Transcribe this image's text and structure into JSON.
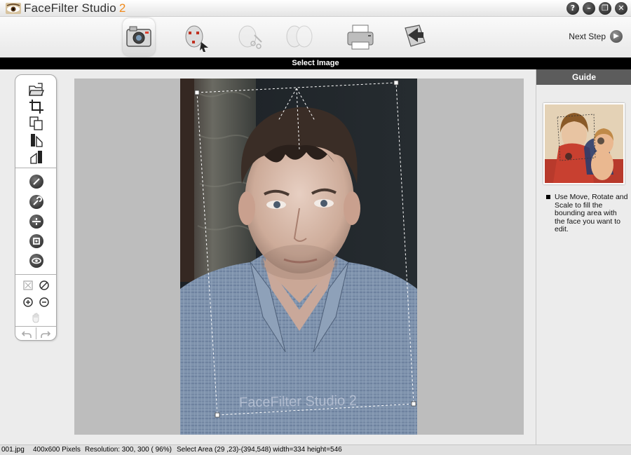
{
  "app": {
    "title": "FaceFilter Studio",
    "version": "2",
    "window_buttons": {
      "help": "?",
      "minimize": "–",
      "restore": "❐",
      "close": "✕"
    }
  },
  "toolbar": {
    "steps": [
      {
        "name": "select-image",
        "icon": "camera-icon",
        "active": true
      },
      {
        "name": "face-detect",
        "icon": "face-points-icon",
        "active": false
      },
      {
        "name": "face-edit",
        "icon": "face-edit-icon",
        "active": false
      },
      {
        "name": "face-compare",
        "icon": "face-compare-icon",
        "active": false
      },
      {
        "name": "print",
        "icon": "printer-icon",
        "active": false
      },
      {
        "name": "export",
        "icon": "export-icon",
        "active": false
      }
    ],
    "next_step_label": "Next Step"
  },
  "step_bar": {
    "label": "Select Image"
  },
  "palette": {
    "top_tools": [
      "open-folder-icon",
      "crop-icon",
      "copy-icon",
      "flip-horizontal-icon",
      "flip-vertical-icon"
    ],
    "round_tools": [
      "contrast-icon",
      "wrench-icon",
      "level-icon",
      "frame-icon",
      "eye-icon"
    ],
    "zoom_tools": [
      "fit-icon",
      "no-zoom-icon",
      "zoom-in-icon",
      "zoom-out-icon",
      "hand-icon"
    ],
    "history_tools": [
      "undo-icon",
      "redo-icon"
    ]
  },
  "canvas": {
    "watermark": "FaceFilter Studio 2"
  },
  "guide": {
    "header": "Guide",
    "instruction": "Use Move, Rotate and Scale to fill the bounding area with the face you want to edit."
  },
  "statusbar": {
    "filename": "001.jpg",
    "size": "400x600 Pixels",
    "resolution": "Resolution: 300, 300 ( 96%)",
    "select_area": "Select Area (29 ,23)-(394,548) width=334  height=546"
  },
  "colors": {
    "title_accent": "#f08a1c",
    "step_bar_bg": "#000000",
    "guide_header_bg": "#5c5c5c",
    "canvas_bg": "#bdbdbd"
  }
}
